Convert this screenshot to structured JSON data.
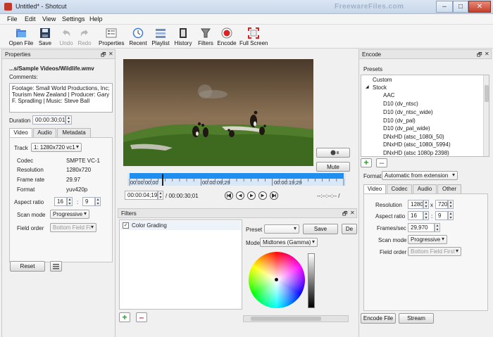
{
  "window": {
    "title": "Untitled* - Shotcut",
    "watermark": "FreewareFiles.com",
    "minimize": "–",
    "maximize": "□",
    "close": "✕"
  },
  "menu": [
    "File",
    "Edit",
    "View",
    "Settings",
    "Help"
  ],
  "toolbar": [
    {
      "label": "Open File",
      "icon": "open-file-icon",
      "enabled": true
    },
    {
      "label": "Save",
      "icon": "save-icon",
      "enabled": true
    },
    {
      "label": "Undo",
      "icon": "undo-icon",
      "enabled": false
    },
    {
      "label": "Redo",
      "icon": "redo-icon",
      "enabled": false
    },
    {
      "label": "Properties",
      "icon": "properties-icon",
      "enabled": true
    },
    {
      "label": "Recent",
      "icon": "recent-icon",
      "enabled": true
    },
    {
      "label": "Playlist",
      "icon": "playlist-icon",
      "enabled": true
    },
    {
      "label": "History",
      "icon": "history-icon",
      "enabled": true
    },
    {
      "label": "Filters",
      "icon": "filters-icon",
      "enabled": true
    },
    {
      "label": "Encode",
      "icon": "encode-icon",
      "enabled": true
    },
    {
      "label": "Full Screen",
      "icon": "full-screen-icon",
      "enabled": true
    }
  ],
  "properties": {
    "title": "Properties",
    "float_btn": "🗗",
    "close_btn": "✕",
    "filename": "...s/Sample Videos/Wildlife.wmv",
    "comments_label": "Comments:",
    "comments": "Footage: Small World Productions, Inc; Tourism New Zealand | Producer: Gary F. Spradling | Music: Steve Ball",
    "duration_label": "Duration",
    "duration": "00:00:30;01",
    "tabs": [
      "Video",
      "Audio",
      "Metadata"
    ],
    "track_label": "Track",
    "track_value": "1: 1280x720 vc1",
    "rows": [
      {
        "label": "Codec",
        "value": "SMPTE VC-1"
      },
      {
        "label": "Resolution",
        "value": "1280x720"
      },
      {
        "label": "Frame rate",
        "value": "29.97"
      },
      {
        "label": "Format",
        "value": "yuv420p"
      }
    ],
    "aspect_label": "Aspect ratio",
    "aspect_w": "16",
    "aspect_h": "9",
    "aspect_sep": ":",
    "scan_label": "Scan mode",
    "scan_value": "Progressive",
    "field_label": "Field order",
    "field_value": "Bottom Field Fi",
    "reset": "Reset"
  },
  "player": {
    "ruler": [
      "00:00:00;00",
      "00:00:09;29",
      "00:00:19;29"
    ],
    "position": "00:00:04;19",
    "total": "/ 00:00:30;01",
    "in_out": "--:--:--:-- /",
    "progress": 0.15,
    "mute": "Mute",
    "controls": [
      "skip-start-icon",
      "rewind-icon",
      "play-icon",
      "fast-forward-icon",
      "skip-end-icon"
    ]
  },
  "filters": {
    "title": "Filters",
    "items": [
      {
        "label": "Color Grading",
        "checked": true
      }
    ],
    "preset_label": "Preset",
    "save": "Save",
    "delete": "De",
    "mode_label": "Mode",
    "mode_value": "Midtones (Gamma)"
  },
  "encode": {
    "title": "Encode",
    "presets_label": "Presets",
    "presets": [
      {
        "label": "Custom",
        "level": 0
      },
      {
        "label": "Stock",
        "level": 0,
        "expanded": true
      },
      {
        "label": "AAC",
        "level": 2
      },
      {
        "label": "D10 (dv_ntsc)",
        "level": 1
      },
      {
        "label": "D10 (dv_ntsc_wide)",
        "level": 1
      },
      {
        "label": "D10 (dv_pal)",
        "level": 1
      },
      {
        "label": "D10 (dv_pal_wide)",
        "level": 1
      },
      {
        "label": "DNxHD (atsc_1080i_50)",
        "level": 1
      },
      {
        "label": "DNxHD (atsc_1080i_5994)",
        "level": 1
      },
      {
        "label": "DNxHD (atsc 1080p 2398)",
        "level": 1
      }
    ],
    "format_label": "Format",
    "format_value": "Automatic from extension",
    "tabs": [
      "Video",
      "Codec",
      "Audio",
      "Other"
    ],
    "resolution_label": "Resolution",
    "res_w": "1280",
    "res_x": "x",
    "res_h": "720",
    "aspect_label": "Aspect ratio",
    "aspect_w": "16",
    "aspect_sep": ":",
    "aspect_h": "9",
    "fps_label": "Frames/sec",
    "fps": "29,970",
    "scan_label": "Scan mode",
    "scan_value": "Progressive",
    "field_label": "Field order",
    "field_value": "Bottom Field First",
    "encode_file": "Encode File",
    "stream": "Stream"
  },
  "colors": {
    "timeline_blue": "#1e8ff0",
    "accent_red": "#d33",
    "add_green": "#2f9b2f"
  }
}
